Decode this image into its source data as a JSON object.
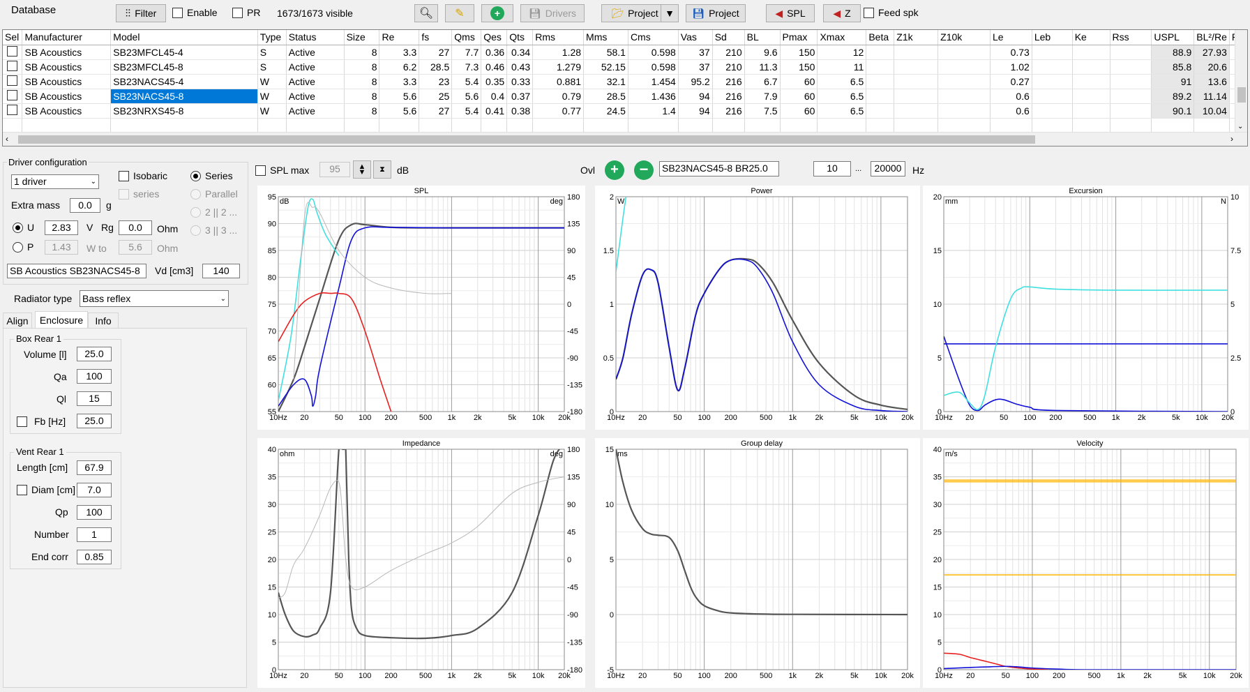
{
  "toolbar": {
    "title": "Database",
    "filter": "Filter",
    "enable": "Enable",
    "pr": "PR",
    "visible": "1673/1673 visible",
    "drivers": "Drivers",
    "project1": "Project",
    "project2": "Project",
    "spl": "SPL",
    "z": "Z",
    "feed_spk": "Feed spk"
  },
  "table": {
    "columns": [
      "Sel",
      "Manufacturer",
      "Model",
      "Type",
      "Status",
      "Size",
      "Re",
      "fs",
      "Qms",
      "Qes",
      "Qts",
      "Rms",
      "Mms",
      "Cms",
      "Vas",
      "Sd",
      "BL",
      "Pmax",
      "Xmax",
      "Beta",
      "Z1k",
      "Z10k",
      "Le",
      "Leb",
      "Ke",
      "Rss",
      "USPL",
      "BL²/Re",
      "Re"
    ],
    "rows": [
      [
        "",
        "SB Acoustics",
        "SB23MFCL45-4",
        "S",
        "Active",
        "8",
        "3.3",
        "27",
        "7.7",
        "0.36",
        "0.34",
        "1.28",
        "58.1",
        "0.598",
        "37",
        "210",
        "9.6",
        "150",
        "12",
        "",
        "",
        "",
        "0.73",
        "",
        "",
        "",
        "88.9",
        "27.93"
      ],
      [
        "",
        "SB Acoustics",
        "SB23MFCL45-8",
        "S",
        "Active",
        "8",
        "6.2",
        "28.5",
        "7.3",
        "0.46",
        "0.43",
        "1.279",
        "52.15",
        "0.598",
        "37",
        "210",
        "11.3",
        "150",
        "11",
        "",
        "",
        "",
        "1.02",
        "",
        "",
        "",
        "85.8",
        "20.6"
      ],
      [
        "",
        "SB Acoustics",
        "SB23NACS45-4",
        "W",
        "Active",
        "8",
        "3.3",
        "23",
        "5.4",
        "0.35",
        "0.33",
        "0.881",
        "32.1",
        "1.454",
        "95.2",
        "216",
        "6.7",
        "60",
        "6.5",
        "",
        "",
        "",
        "0.27",
        "",
        "",
        "",
        "91",
        "13.6"
      ],
      [
        "",
        "SB Acoustics",
        "SB23NACS45-8",
        "W",
        "Active",
        "8",
        "5.6",
        "25",
        "5.6",
        "0.4",
        "0.37",
        "0.79",
        "28.5",
        "1.436",
        "94",
        "216",
        "7.9",
        "60",
        "6.5",
        "",
        "",
        "",
        "0.6",
        "",
        "",
        "",
        "89.2",
        "11.14"
      ],
      [
        "",
        "SB Acoustics",
        "SB23NRXS45-8",
        "W",
        "Active",
        "8",
        "5.6",
        "27",
        "5.4",
        "0.41",
        "0.38",
        "0.77",
        "24.5",
        "1.4",
        "94",
        "216",
        "7.5",
        "60",
        "6.5",
        "",
        "",
        "",
        "0.6",
        "",
        "",
        "",
        "90.1",
        "10.04"
      ]
    ],
    "selected_row": 3
  },
  "driver": {
    "group_title": "Driver configuration",
    "count": "1 driver",
    "isobaric": "Isobaric",
    "series_chk": "series",
    "series": "Series",
    "parallel": "Parallel",
    "p2": "2 || 2 ...",
    "p3": "3 || 3 ...",
    "extra_mass_label": "Extra mass",
    "extra_mass": "0.0",
    "extra_mass_unit": "g",
    "u_label": "U",
    "u_value": "2.83",
    "u_unit": "V",
    "rg_label": "Rg",
    "rg_value": "0.0",
    "rg_unit": "Ohm",
    "p_label": "P",
    "p_value": "1.43",
    "p_unit": "W to",
    "p_ohm": "5.6",
    "p_ohm_unit": "Ohm",
    "name": "SB Acoustics SB23NACS45-8",
    "vd_label": "Vd [cm3]",
    "vd_value": "140"
  },
  "radiator": {
    "label": "Radiator type",
    "value": "Bass reflex"
  },
  "tabs": [
    "Align",
    "Enclosure",
    "Info"
  ],
  "box": {
    "title": "Box Rear 1",
    "volume_label": "Volume [l]",
    "volume": "25.0",
    "qa_label": "Qa",
    "qa": "100",
    "ql_label": "Ql",
    "ql": "15",
    "fb_label": "Fb [Hz]",
    "fb": "25.0"
  },
  "vent": {
    "title": "Vent Rear 1",
    "length_label": "Length [cm]",
    "length": "67.9",
    "diam_label": "Diam [cm]",
    "diam": "7.0",
    "qp_label": "Qp",
    "qp": "100",
    "number_label": "Number",
    "number": "1",
    "endcorr_label": "End corr",
    "endcorr": "0.85"
  },
  "spl_bar": {
    "splmax": "SPL max",
    "splmax_value": "95",
    "db": "dB",
    "ovl": "Ovl",
    "overlay": "SB23NACS45-8 BR25.0",
    "fmin": "10",
    "sep": "...",
    "fmax": "20000",
    "hz": "Hz"
  },
  "x_ticks": [
    "10Hz",
    "20",
    "50",
    "100",
    "200",
    "500",
    "1k",
    "2k",
    "5k",
    "10k",
    "20k"
  ],
  "colors": {
    "dark": "#555555",
    "blue": "#1010d8",
    "cyan": "#40e0e0",
    "red": "#e82020",
    "gray": "#b8b8b8",
    "orange": "#ffb400",
    "select": "#0078d7"
  },
  "plots": {
    "spl": {
      "title": "SPL",
      "left_unit": "dB",
      "right_unit": "deg",
      "left": [
        "95",
        "90",
        "85",
        "80",
        "75",
        "70",
        "65",
        "60",
        "55"
      ],
      "right": [
        "180",
        "135",
        "90",
        "45",
        "0",
        "-45",
        "-90",
        "-135",
        "-180"
      ]
    },
    "power": {
      "title": "Power",
      "left_unit": "W",
      "right_unit": "",
      "left": [
        "2",
        "1.5",
        "1",
        "0.5",
        "0"
      ],
      "right": []
    },
    "excursion": {
      "title": "Excursion",
      "left_unit": "mm",
      "right_unit": "N",
      "left": [
        "20",
        "15",
        "10",
        "5",
        "0"
      ],
      "right": [
        "10",
        "7.5",
        "5",
        "2.5",
        "0"
      ]
    },
    "impedance": {
      "title": "Impedance",
      "left_unit": "ohm",
      "right_unit": "deg",
      "left": [
        "40",
        "35",
        "30",
        "25",
        "20",
        "15",
        "10",
        "5",
        "0"
      ],
      "right": [
        "180",
        "135",
        "90",
        "45",
        "0",
        "-45",
        "-90",
        "-135",
        "-180"
      ]
    },
    "group_delay": {
      "title": "Group delay",
      "left_unit": "ms",
      "right_unit": "",
      "left": [
        "15",
        "10",
        "5",
        "0",
        "-5"
      ],
      "right": []
    },
    "velocity": {
      "title": "Velocity",
      "left_unit": "m/s",
      "right_unit": "",
      "left": [
        "40",
        "35",
        "30",
        "25",
        "20",
        "15",
        "10",
        "5",
        "0"
      ],
      "right": []
    }
  },
  "chart_data": [
    {
      "type": "line",
      "title": "SPL",
      "xlabel": "",
      "ylabel": "dB",
      "x_scale": "log",
      "xlim": [
        10,
        20000
      ],
      "ylim": [
        55,
        95
      ],
      "y2lim": [
        -180,
        180
      ],
      "series": [
        {
          "color": "#555555",
          "x": [
            10,
            15,
            20,
            30,
            50,
            70,
            100,
            200,
            500,
            1000,
            20000
          ],
          "y": [
            55,
            61,
            67,
            76,
            87,
            89.8,
            89.8,
            89.3,
            89.2,
            89.2,
            89.2
          ]
        },
        {
          "color": "#1010d8",
          "x": [
            10,
            15,
            20,
            24,
            25,
            27,
            30,
            50,
            70,
            100,
            200,
            1000,
            20000
          ],
          "y": [
            56,
            60,
            61,
            58,
            56,
            58,
            63,
            78,
            87,
            89.2,
            89.3,
            89.2,
            89.2
          ]
        },
        {
          "color": "#40e0e0",
          "x": [
            10,
            14,
            18,
            22,
            25,
            28,
            35,
            50
          ],
          "y": [
            57,
            69,
            83,
            93,
            94.5,
            92,
            88,
            84
          ]
        },
        {
          "color": "#e82020",
          "x": [
            10,
            15,
            20,
            30,
            40,
            50,
            70,
            100,
            150,
            200
          ],
          "y": [
            68,
            73,
            75.5,
            77,
            77,
            77,
            76,
            70,
            61,
            55
          ]
        },
        {
          "color": "#b8b8b8",
          "x": [
            15,
            20,
            25,
            30,
            50,
            100,
            200,
            500,
            1000
          ],
          "y": [
            61,
            91,
            93,
            92,
            85,
            80,
            78,
            77,
            77
          ]
        }
      ]
    },
    {
      "type": "line",
      "title": "Power",
      "ylabel": "W",
      "x_scale": "log",
      "xlim": [
        10,
        20000
      ],
      "ylim": [
        0,
        2
      ],
      "series": [
        {
          "color": "#555555",
          "x": [
            10,
            12,
            15,
            20,
            25,
            30,
            40,
            50,
            60,
            80,
            100,
            150,
            200,
            300,
            400,
            600,
            1000,
            2000,
            5000,
            10000,
            20000
          ],
          "y": [
            0.3,
            0.5,
            0.9,
            1.27,
            1.32,
            1.2,
            0.6,
            0.2,
            0.4,
            0.9,
            1.1,
            1.33,
            1.41,
            1.42,
            1.38,
            1.2,
            0.85,
            0.45,
            0.15,
            0.06,
            0.02
          ]
        },
        {
          "color": "#1010d8",
          "x": [
            10,
            12,
            15,
            20,
            25,
            30,
            40,
            50,
            60,
            80,
            100,
            150,
            200,
            300,
            400,
            600,
            1000,
            2000,
            5000,
            10000,
            20000
          ],
          "y": [
            0.3,
            0.5,
            0.9,
            1.27,
            1.32,
            1.2,
            0.6,
            0.2,
            0.4,
            0.9,
            1.1,
            1.33,
            1.41,
            1.41,
            1.34,
            1.1,
            0.65,
            0.25,
            0.05,
            0.01,
            0.0
          ]
        },
        {
          "color": "#40e0e0",
          "x": [
            10,
            12,
            13
          ],
          "y": [
            1.3,
            1.8,
            2.0
          ]
        }
      ]
    },
    {
      "type": "line",
      "title": "Excursion",
      "ylabel": "mm",
      "y2label": "N",
      "x_scale": "log",
      "xlim": [
        10,
        20000
      ],
      "ylim": [
        0,
        20
      ],
      "y2lim": [
        0,
        10
      ],
      "series": [
        {
          "color": "#1010d8",
          "x": [
            10,
            15,
            20,
            25,
            30,
            40,
            50,
            70,
            100,
            200,
            20000
          ],
          "y": [
            7,
            3,
            0.6,
            0.1,
            0.6,
            1.1,
            1.1,
            0.7,
            0.4,
            0.1,
            0
          ]
        },
        {
          "color": "#1010d8",
          "x": [
            10,
            20000
          ],
          "y": [
            6.3,
            6.3
          ]
        },
        {
          "color": "#40e0e0",
          "x": [
            10,
            15,
            20,
            25,
            30,
            40,
            60,
            80,
            100,
            200,
            1000,
            20000
          ],
          "y": [
            1.5,
            1.8,
            0.8,
            0.2,
            1.5,
            6,
            10.5,
            11.5,
            11.6,
            11.4,
            11.3,
            11.3
          ]
        }
      ]
    },
    {
      "type": "line",
      "title": "Impedance",
      "ylabel": "ohm",
      "y2label": "deg",
      "x_scale": "log",
      "xlim": [
        10,
        20000
      ],
      "ylim": [
        0,
        40
      ],
      "y2lim": [
        -180,
        180
      ],
      "series": [
        {
          "color": "#555555",
          "x": [
            10,
            12,
            15,
            20,
            25,
            30,
            40,
            50,
            55,
            58,
            60,
            65,
            70,
            80,
            100,
            200,
            500,
            1000,
            2000,
            5000,
            10000,
            15000,
            20000
          ],
          "y": [
            14,
            10,
            7,
            6,
            6.3,
            7.5,
            14,
            40,
            40,
            40,
            40,
            20,
            11,
            7.5,
            6.2,
            5.8,
            5.7,
            6.2,
            7.5,
            14,
            28,
            38,
            41
          ]
        },
        {
          "color": "#b8b8b8",
          "x": [
            10,
            12,
            15,
            20,
            30,
            40,
            50,
            55,
            60,
            70,
            100,
            200,
            500,
            1000,
            2000,
            5000,
            10000,
            20000
          ],
          "y": [
            13,
            14,
            19,
            22,
            28,
            33,
            34,
            28,
            20,
            15,
            15,
            18,
            21,
            23,
            26,
            32,
            34,
            35
          ]
        }
      ]
    },
    {
      "type": "line",
      "title": "Group delay",
      "ylabel": "ms",
      "x_scale": "log",
      "xlim": [
        10,
        20000
      ],
      "ylim": [
        -5,
        15
      ],
      "series": [
        {
          "color": "#555555",
          "x": [
            10,
            12,
            15,
            20,
            25,
            30,
            40,
            50,
            60,
            70,
            80,
            100,
            150,
            200,
            300,
            500,
            1000,
            20000
          ],
          "y": [
            15,
            12,
            9.5,
            7.8,
            7.3,
            7.2,
            7.0,
            5.8,
            4,
            2.5,
            1.6,
            0.8,
            0.3,
            0.15,
            0.08,
            0.04,
            0.02,
            0
          ]
        }
      ]
    },
    {
      "type": "line",
      "title": "Velocity",
      "ylabel": "m/s",
      "x_scale": "log",
      "xlim": [
        10,
        20000
      ],
      "ylim": [
        0,
        40
      ],
      "series": [
        {
          "color": "#ffb400",
          "x": [
            10,
            20000
          ],
          "y": [
            34.4,
            34.4
          ]
        },
        {
          "color": "#ffb400",
          "x": [
            10,
            20000
          ],
          "y": [
            34.1,
            34.1
          ]
        },
        {
          "color": "#ffb400",
          "x": [
            10,
            20000
          ],
          "y": [
            17.2,
            17.2
          ]
        },
        {
          "color": "#e82020",
          "x": [
            10,
            15,
            20,
            30,
            40,
            50,
            70,
            100,
            150
          ],
          "y": [
            3,
            2.8,
            2.2,
            1.5,
            1.0,
            0.6,
            0.3,
            0.1,
            0
          ]
        },
        {
          "color": "#1010d8",
          "x": [
            10,
            20,
            30,
            50,
            70,
            100,
            200,
            500,
            20000
          ],
          "y": [
            0.2,
            0.4,
            0.5,
            0.6,
            0.5,
            0.3,
            0.1,
            0,
            0
          ]
        }
      ]
    }
  ]
}
